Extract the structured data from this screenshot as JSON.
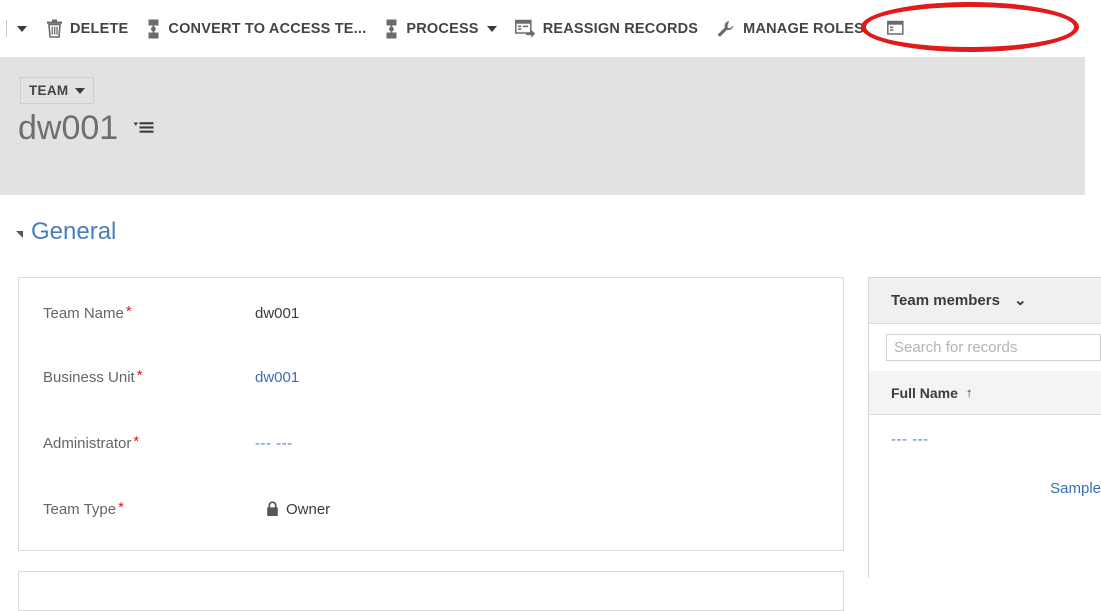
{
  "commandbar": {
    "leading_caret_icon": "chevron-down-icon",
    "buttons": [
      {
        "label": "DELETE",
        "icon": "trash-icon",
        "has_caret": false
      },
      {
        "label": "CONVERT TO ACCESS TE...",
        "icon": "convert-icon",
        "has_caret": false
      },
      {
        "label": "PROCESS",
        "icon": "process-icon",
        "has_caret": true
      },
      {
        "label": "REASSIGN RECORDS",
        "icon": "reassign-records-icon",
        "has_caret": false
      },
      {
        "label": "MANAGE ROLES",
        "icon": "wrench-icon",
        "has_caret": false
      }
    ],
    "overflow_icon": "more-commands-icon"
  },
  "annotation": {
    "shape": "ellipse",
    "color": "#e01b1b",
    "targets": "MANAGE ROLES"
  },
  "header": {
    "entity_chip_label": "TEAM",
    "entity_chip_caret_icon": "chevron-down-icon",
    "record_title": "dw001",
    "form_selector_icon": "form-selector-icon"
  },
  "section": {
    "toggle_icon": "collapse-triangle-icon",
    "title": "General"
  },
  "form": {
    "fields": [
      {
        "label": "Team Name",
        "required": true,
        "value": "dw001",
        "value_style": "text"
      },
      {
        "label": "Business Unit",
        "required": true,
        "value": "dw001",
        "value_style": "link"
      },
      {
        "label": "Administrator",
        "required": true,
        "value": "--- ---",
        "value_style": "link-muted"
      },
      {
        "label": "Team Type",
        "required": true,
        "value": "Owner",
        "value_style": "text",
        "value_icon": "lock-icon"
      }
    ],
    "required_marker": "*"
  },
  "right_panel": {
    "title": "Team members",
    "chevron_icon": "chevron-down-icon",
    "search_placeholder": "Search for records",
    "search_value": "",
    "column_header": "Full Name",
    "sort_arrow": "↑",
    "sort_direction": "ascending",
    "rows": [
      {
        "label": "--- ---",
        "align": "left"
      },
      {
        "label": "Sample",
        "align": "right"
      }
    ]
  },
  "colors": {
    "accent_link": "#3b6fb6",
    "section_title": "#4a7ebb",
    "annotation_red": "#e01b1b",
    "header_band": "#e2e2e2",
    "required_star": "#cc2222"
  }
}
